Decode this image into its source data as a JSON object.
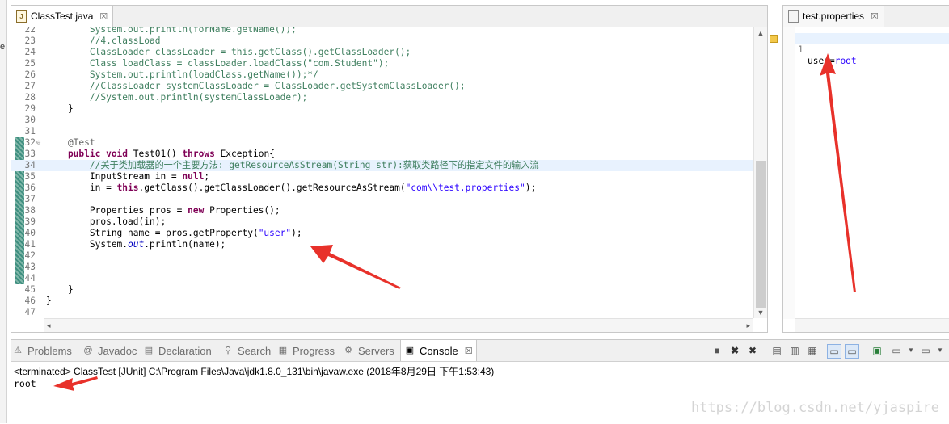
{
  "editor": {
    "tab_label": "ClassTest.java",
    "tab_close": "☒",
    "lines": [
      {
        "n": "22",
        "segs": [
          {
            "c": "c-com",
            "t": "        System.out.println(forName.getName());"
          }
        ]
      },
      {
        "n": "23",
        "segs": [
          {
            "c": "c-com",
            "t": "        //4.classLoad"
          }
        ]
      },
      {
        "n": "24",
        "segs": [
          {
            "c": "c-com",
            "t": "        ClassLoader classLoader = this.getClass().getClassLoader();"
          }
        ]
      },
      {
        "n": "25",
        "segs": [
          {
            "c": "c-com",
            "t": "        Class loadClass = classLoader.loadClass(\"com.Student\");"
          }
        ]
      },
      {
        "n": "26",
        "segs": [
          {
            "c": "c-com",
            "t": "        System.out.println(loadClass.getName());*/"
          }
        ]
      },
      {
        "n": "27",
        "segs": [
          {
            "c": "c-com",
            "t": "        //ClassLoader systemClassLoader = ClassLoader.getSystemClassLoader();"
          }
        ]
      },
      {
        "n": "28",
        "segs": [
          {
            "c": "c-com",
            "t": "        //System.out.println(systemClassLoader);"
          }
        ]
      },
      {
        "n": "29",
        "segs": [
          {
            "c": "",
            "t": "    }"
          }
        ]
      },
      {
        "n": "30",
        "segs": []
      },
      {
        "n": "31",
        "segs": []
      },
      {
        "n": "32",
        "fold": "⊖",
        "segs": [
          {
            "c": "c-ann",
            "t": "    @Test"
          }
        ]
      },
      {
        "n": "33",
        "segs": [
          {
            "c": "c-kw",
            "t": "    public void "
          },
          {
            "c": "",
            "t": "Test01() "
          },
          {
            "c": "c-kw",
            "t": "throws "
          },
          {
            "c": "",
            "t": "Exception{"
          }
        ]
      },
      {
        "n": "34",
        "current": true,
        "segs": [
          {
            "c": "c-com",
            "t": "        //关于类加载器的一个主要方法: getResourceAsStream(String str):获取类路径下的指定文件的输入流"
          }
        ]
      },
      {
        "n": "35",
        "segs": [
          {
            "c": "",
            "t": "        InputStream in = "
          },
          {
            "c": "c-kw",
            "t": "null"
          },
          {
            "c": "",
            "t": ";"
          }
        ]
      },
      {
        "n": "36",
        "segs": [
          {
            "c": "",
            "t": "        in = "
          },
          {
            "c": "c-kw",
            "t": "this"
          },
          {
            "c": "",
            "t": ".getClass().getClassLoader().getResourceAsStream("
          },
          {
            "c": "c-str",
            "t": "\"com\\\\test.properties\""
          },
          {
            "c": "",
            "t": ");"
          }
        ]
      },
      {
        "n": "37",
        "segs": []
      },
      {
        "n": "38",
        "segs": [
          {
            "c": "",
            "t": "        Properties pros = "
          },
          {
            "c": "c-kw",
            "t": "new "
          },
          {
            "c": "",
            "t": "Properties();"
          }
        ]
      },
      {
        "n": "39",
        "segs": [
          {
            "c": "",
            "t": "        pros.load(in);"
          }
        ]
      },
      {
        "n": "40",
        "segs": [
          {
            "c": "",
            "t": "        String name = pros.getProperty("
          },
          {
            "c": "c-str",
            "t": "\"user\""
          },
          {
            "c": "",
            "t": ");"
          }
        ]
      },
      {
        "n": "41",
        "segs": [
          {
            "c": "",
            "t": "        System."
          },
          {
            "c": "c-ital",
            "t": "out"
          },
          {
            "c": "",
            "t": ".println(name);"
          }
        ]
      },
      {
        "n": "42",
        "segs": []
      },
      {
        "n": "43",
        "segs": []
      },
      {
        "n": "44",
        "segs": []
      },
      {
        "n": "45",
        "segs": [
          {
            "c": "",
            "t": "    }"
          }
        ]
      },
      {
        "n": "46",
        "segs": [
          {
            "c": "",
            "t": "}"
          }
        ]
      },
      {
        "n": "47",
        "segs": []
      }
    ]
  },
  "properties": {
    "tab_label": "test.properties",
    "tab_close": "☒",
    "line_number": "1",
    "key": "user",
    "eq": "=",
    "value": "root"
  },
  "console": {
    "tabs": [
      {
        "label": "Problems",
        "icon": "problems-icon",
        "glyph": "⚠"
      },
      {
        "label": "Javadoc",
        "icon": "javadoc-icon",
        "glyph": "@"
      },
      {
        "label": "Declaration",
        "icon": "declaration-icon",
        "glyph": "▤"
      },
      {
        "label": "Search",
        "icon": "search-icon",
        "glyph": "⚲"
      },
      {
        "label": "Progress",
        "icon": "progress-icon",
        "glyph": "▦"
      },
      {
        "label": "Servers",
        "icon": "servers-icon",
        "glyph": "⚙"
      },
      {
        "label": "Console",
        "icon": "console-icon",
        "glyph": "▣",
        "active": true
      }
    ],
    "status": "<terminated> ClassTest [JUnit] C:\\Program Files\\Java\\jdk1.8.0_131\\bin\\javaw.exe (2018年8月29日 下午1:53:43)",
    "output": "root",
    "close": "☒"
  },
  "watermark": "https://blog.csdn.net/yjaspire",
  "colors": {
    "arrow": "#e8312a",
    "comment": "#3f7f5f",
    "keyword": "#7f0055",
    "string": "#2a00ff"
  }
}
